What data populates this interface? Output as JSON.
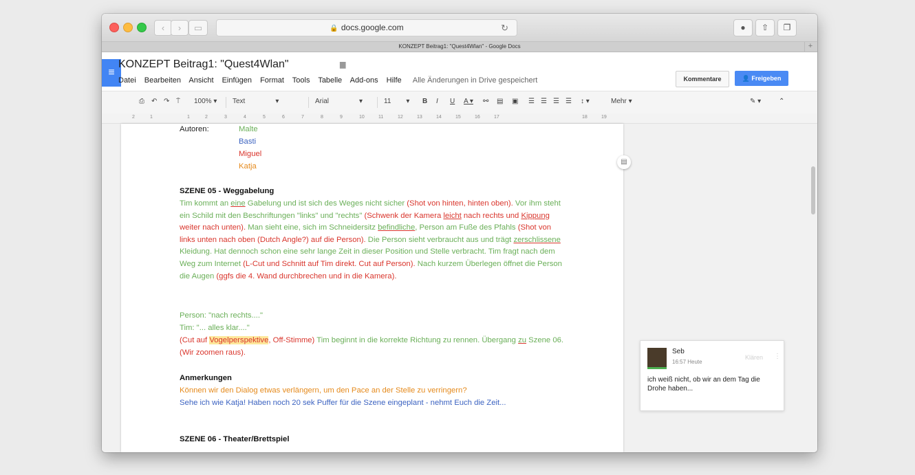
{
  "browser": {
    "url": "docs.google.com",
    "tab_title": "KONZEPT Beitrag1: \"Quest4Wlan\" - Google Docs"
  },
  "doc": {
    "title": "KONZEPT Beitrag1: \"Quest4Wlan\"",
    "menu": [
      "Datei",
      "Bearbeiten",
      "Ansicht",
      "Einfügen",
      "Format",
      "Tools",
      "Tabelle",
      "Add-ons",
      "Hilfe"
    ],
    "saved_status": "Alle Änderungen in Drive gespeichert",
    "comments_button": "Kommentare",
    "share_button": "Freigeben"
  },
  "toolbar": {
    "zoom": "100%",
    "style": "Text",
    "font": "Arial",
    "size": "11",
    "more": "Mehr"
  },
  "ruler": [
    "2",
    "1",
    "1",
    "2",
    "3",
    "4",
    "5",
    "6",
    "7",
    "8",
    "9",
    "10",
    "11",
    "12",
    "13",
    "14",
    "15",
    "16",
    "17",
    "18",
    "19"
  ],
  "content": {
    "authors_label": "Autoren:",
    "authors": [
      "Malte",
      "Basti",
      "Miguel",
      "Katja"
    ],
    "scene05_title": "SZENE 05 - Weggabelung",
    "s1": "Tim kommt an ",
    "s2": "eine",
    "s3": " Gabelung und ist sich des Weges nicht sicher ",
    "s4": "(Shot von hinten, hinten oben).",
    "s5": " Vor ihm steht ein Schild mit den Beschriftungen \"links\" und \"rechts\" ",
    "s6": "(Schwenk der Kamera ",
    "s7": "leicht",
    "s8": " nach rechts und ",
    "s9": "Kippung",
    "s10": " weiter nach unten).",
    "s11": "  Man sieht eine, sich im Schneidersitz ",
    "s12": "befindliche",
    "s13": ", Person am Fuße des Pfahls ",
    "s14": "(Shot von links unten nach oben (Dutch Angle?) auf die Person).",
    "s15": " Die Person sieht verbraucht aus und trägt ",
    "s16": "zerschlissene",
    "s17": " Kleidung. Hat dennoch schon eine sehr lange Zeit in dieser Position und Stelle verbracht. Tim fragt nach dem Weg zum Internet ",
    "s18": "(L-Cut und Schnitt auf Tim direkt. Cut auf Person).",
    "s19": " Nach kurzem Überlegen öffnet die Person die Augen ",
    "s20": "(ggfs die 4. Wand durchbrechen und in die Kamera).",
    "line_person": "Person: \"nach rechts....\"",
    "line_tim": "Tim: \"... alles klar....\"",
    "c1": "(Cut auf ",
    "c2": "Vogelperspektive",
    "c3": ", Off-Stimme)",
    "c4": " Tim beginnt in die korrekte Richtung zu rennen. Übergang ",
    "c5": "zu",
    "c6": " Szene 06. ",
    "c7": "(Wir zoomen raus).",
    "notes_title": "Anmerkungen",
    "note1": "Können wir den Dialog etwas verlängern, um den Pace an der Stelle zu verringern?",
    "note2": "Sehe ich wie Katja! Haben noch 20 sek Puffer für die Szene eingeplant - nehmt Euch die Zeit...",
    "scene06_title": "SZENE 06 - Theater/Brettspiel"
  },
  "comment": {
    "author": "Seb",
    "time": "16:57 Heute",
    "resolve": "Klären",
    "text": "ich weiß nicht, ob wir an dem Tag die Drohe haben..."
  },
  "colors": {
    "malte": "#6aaf58",
    "basti": "#3c63c1",
    "miguel": "#d9352c",
    "katja": "#e58a1c",
    "accent": "#4285f4"
  }
}
